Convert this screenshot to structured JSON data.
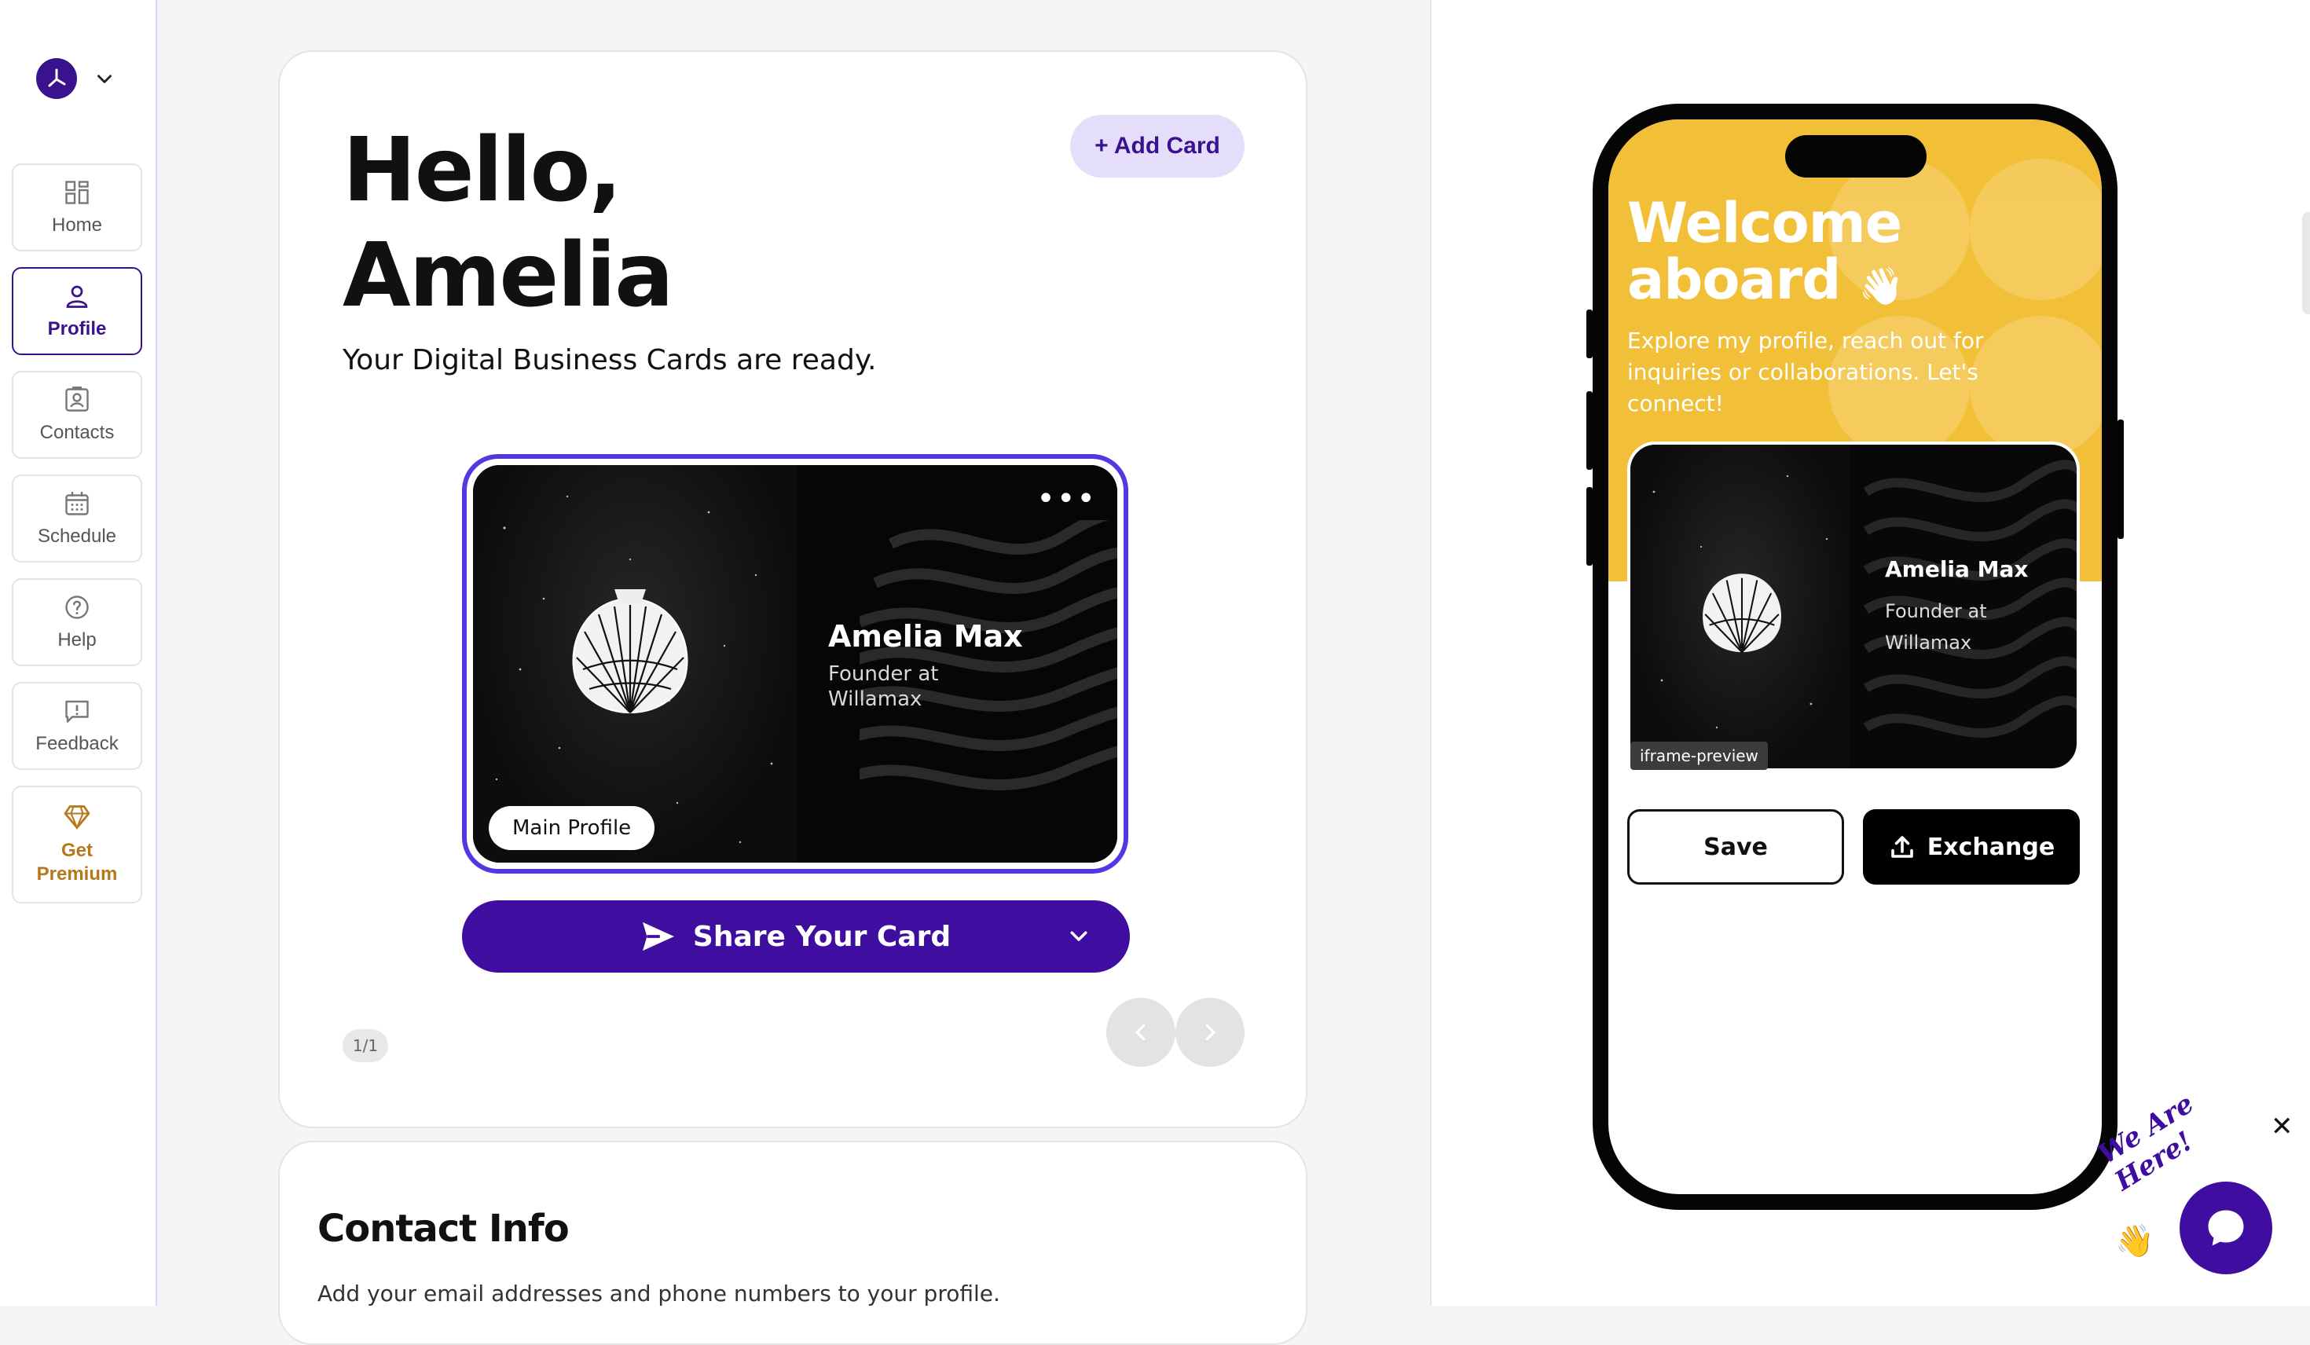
{
  "sidebar": {
    "items": [
      {
        "label": "Home",
        "icon": "dashboard-icon"
      },
      {
        "label": "Profile",
        "icon": "user-icon",
        "active": true
      },
      {
        "label": "Contacts",
        "icon": "contacts-icon"
      },
      {
        "label": "Schedule",
        "icon": "calendar-icon"
      },
      {
        "label": "Help",
        "icon": "help-icon"
      },
      {
        "label": "Feedback",
        "icon": "feedback-icon"
      }
    ],
    "premium": {
      "line1": "Get",
      "line2": "Premium",
      "icon": "diamond-icon"
    }
  },
  "header": {
    "greeting_line1": "Hello,",
    "greeting_line2": "Amelia",
    "subtitle": "Your Digital Business Cards are ready.",
    "add_card_label": "+ Add Card"
  },
  "business_card": {
    "name": "Amelia Max",
    "role": "Founder at Willamax",
    "menu": "•••",
    "tag": "Main Profile"
  },
  "share_button": {
    "label": "Share Your Card"
  },
  "pager": {
    "text": "1/1"
  },
  "contact_info": {
    "title": "Contact Info",
    "subtitle": "Add your email addresses and phone numbers to your profile."
  },
  "preview": {
    "welcome_line1": "Welcome",
    "welcome_line2": "aboard",
    "wave": "👋",
    "intro": "Explore my profile, reach out for inquiries or collaborations. Let's connect!",
    "card_name": "Amelia Max",
    "card_role_line1": "Founder at",
    "card_role_line2": "Willamax",
    "iframe_label": "iframe-preview",
    "save_label": "Save",
    "exchange_label": "Exchange"
  },
  "chat_widget": {
    "script_text": "We Are Here!",
    "close": "✕",
    "hand": "👋"
  },
  "colors": {
    "brand": "#3f0ea0",
    "accent_outline": "#5039e0",
    "premium": "#b5781a",
    "preview_hero": "#f2c038"
  }
}
